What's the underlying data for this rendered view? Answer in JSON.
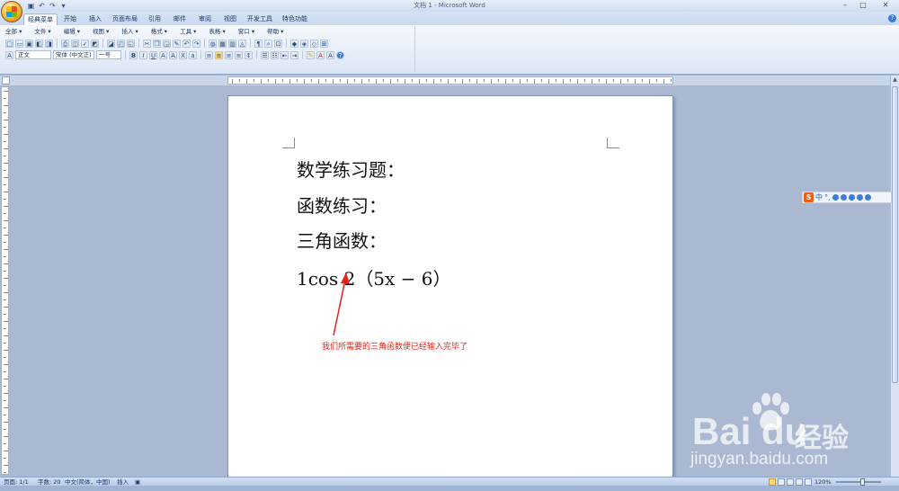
{
  "window": {
    "title": "文档 1 - Microsoft Word",
    "controls": [
      "–",
      "□",
      "✕"
    ]
  },
  "quick_access": [
    "save",
    "undo",
    "redo",
    "more"
  ],
  "tabs": [
    {
      "label": "经典菜单",
      "active": true
    },
    {
      "label": "开始",
      "active": false
    },
    {
      "label": "插入",
      "active": false
    },
    {
      "label": "页面布局",
      "active": false
    },
    {
      "label": "引用",
      "active": false
    },
    {
      "label": "邮件",
      "active": false
    },
    {
      "label": "审阅",
      "active": false
    },
    {
      "label": "视图",
      "active": false
    },
    {
      "label": "开发工具",
      "active": false
    },
    {
      "label": "特色功能",
      "active": false
    }
  ],
  "classic_menu": [
    "全部 ▾",
    "文件 ▾",
    "编辑 ▾",
    "视图 ▾",
    "插入 ▾",
    "格式 ▾",
    "工具 ▾",
    "表格 ▾",
    "窗口 ▾",
    "帮助 ▾"
  ],
  "format_bar": {
    "style": "正文",
    "font": "宋体 (中文正)",
    "size": "一号",
    "bold": "B",
    "italic": "I",
    "underline": "U"
  },
  "document": {
    "lines": [
      "数学练习题：",
      "函数练习：",
      "三角函数："
    ],
    "formula": "1cos 2（5x − 6）",
    "annotation": "我们所需要的三角函数便已经输入完毕了"
  },
  "ime": {
    "logo": "S",
    "mode": "中",
    "punct": "°,"
  },
  "statusbar": {
    "page": "页面: 1/1",
    "words": "字数: 20",
    "language": "中文(简体，中国)",
    "insert_mode": "插入",
    "zoom": "120%"
  },
  "watermark": {
    "brand": "Bai  du",
    "product": "经验",
    "url": "jingyan.baidu.com"
  },
  "colors": {
    "accent": "#e2231a",
    "ribbon": "#dbe6f4",
    "workspace": "#aab9d1"
  }
}
